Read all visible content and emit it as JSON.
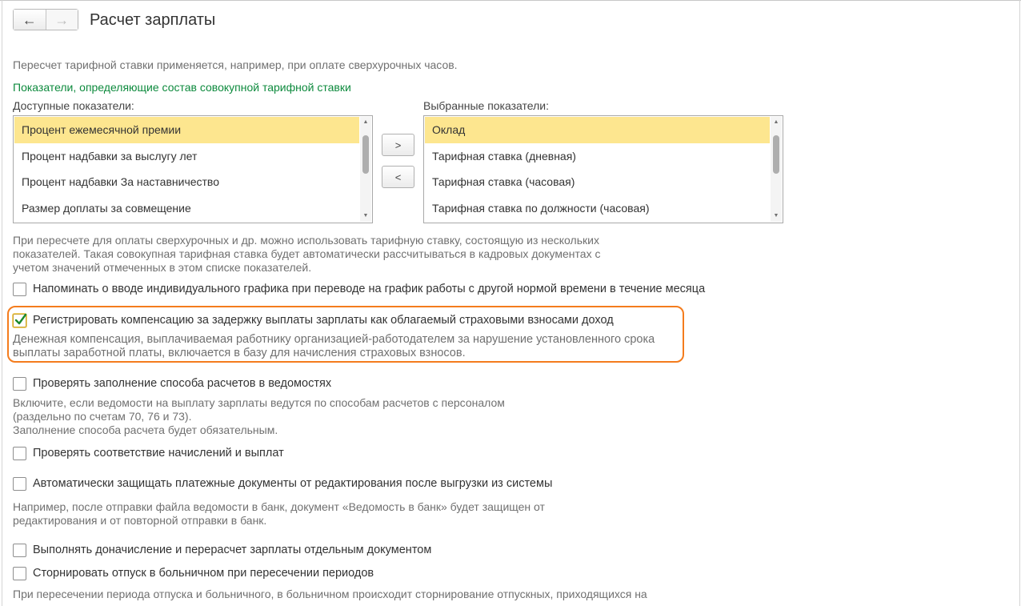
{
  "header": {
    "back_icon": "←",
    "forward_icon": "→",
    "title": "Расчет зарплаты"
  },
  "notes": {
    "recalc": "Пересчет тарифной ставки применяется, например, при оплате сверхурочных часов.",
    "composite": "При пересчете для оплаты сверхурочных и др. можно использовать тарифную ставку, состоящую из нескольких\nпоказателей. Такая совокупная тарифная ставка будет автоматически рассчитываться в кадровых документах с\nучетом значений отмеченных в этом списке показателей."
  },
  "indicators": {
    "section_title": "Показатели, определяющие состав совокупной тарифной ставки",
    "available_label": "Доступные показатели:",
    "selected_label": "Выбранные показатели:",
    "available_items": [
      "Процент ежемесячной премии",
      "Процент надбавки за выслугу лет",
      "Процент надбавки За наставничество",
      "Размер доплаты за совмещение"
    ],
    "selected_items": [
      "Оклад",
      "Тарифная ставка (дневная)",
      "Тарифная ставка (часовая)",
      "Тарифная ставка по должности (часовая)"
    ],
    "add_button": ">",
    "remove_button": "<",
    "scroll_up": "▲",
    "scroll_down": "▼"
  },
  "options": [
    {
      "label": "Напоминать о вводе индивидуального графика при переводе на график работы с другой нормой времени в течение месяца",
      "checked": false
    },
    {
      "label": "Регистрировать компенсацию за задержку выплаты зарплаты как облагаемый страховыми взносами доход",
      "checked": true
    },
    {
      "label": "Проверять заполнение способа расчетов в ведомостях",
      "checked": false
    },
    {
      "label": "Проверять соответствие начислений и выплат",
      "checked": false
    },
    {
      "label": "Автоматически защищать платежные документы от редактирования после выгрузки из системы",
      "checked": false
    },
    {
      "label": "Выполнять доначисление и перерасчет зарплаты отдельным документом",
      "checked": false
    },
    {
      "label": "Сторнировать отпуск в больничном при пересечении периодов",
      "checked": false
    }
  ],
  "hints": {
    "compensation": "Денежная компенсация, выплачиваемая работнику организацией-работодателем за нарушение установленного срока\nвыплаты заработной платы, включается в базу для начисления страховых взносов.",
    "payment_method": "Включите, если ведомости на выплату зарплаты ведутся по способам расчетов с персоналом\n(раздельно по счетам 70, 76 и 73).\nЗаполнение способа расчета будет обязательным.",
    "protect": "Например, после отправки файла ведомости в банк, документ «Ведомость в банк» будет защищен от\nредактирования и от повторной отправки в банк.",
    "storno": "При пересечении периода отпуска и больничного, в больничном происходит сторнирование отпускных, приходящихся на"
  },
  "colors": {
    "accent_green": "#0d8a3d",
    "selection_yellow": "#fde68f",
    "highlight_orange": "#f47c1d",
    "check_green": "#1a8a2e"
  }
}
